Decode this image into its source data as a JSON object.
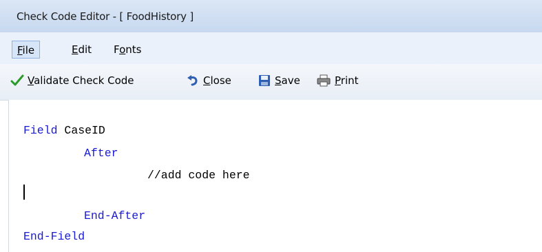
{
  "window": {
    "title": "Check Code Editor - [ FoodHistory ]"
  },
  "menu": {
    "items": [
      {
        "label": "File",
        "underline": "F",
        "rest": "ile",
        "active": true
      },
      {
        "label": "Edit",
        "underline": "E",
        "rest": "dit",
        "active": false
      },
      {
        "label": "Fonts",
        "underline": "o",
        "pre": "F",
        "rest": "nts",
        "active": false
      }
    ]
  },
  "toolbar": {
    "validate_label": "Validate Check Code",
    "close_label": "Close",
    "save_label": "Save",
    "print_label": "Print",
    "icons": [
      "checkmark-icon",
      "undo-arrow-icon",
      "floppy-disk-icon",
      "printer-icon"
    ]
  },
  "editor": {
    "lines": [
      {
        "keyword": "Field",
        "text": " CaseID"
      },
      {
        "keyword": "After",
        "text": ""
      },
      {
        "keyword": "",
        "text": "//add code here"
      },
      {
        "keyword": "",
        "text": ""
      },
      {
        "keyword": "End-After",
        "text": ""
      },
      {
        "keyword": "End-Field",
        "text": ""
      }
    ]
  },
  "colors": {
    "keyword": "#1a1ad6",
    "menu_active_border": "#8fb1de",
    "title_bar": "#cfdef2"
  }
}
